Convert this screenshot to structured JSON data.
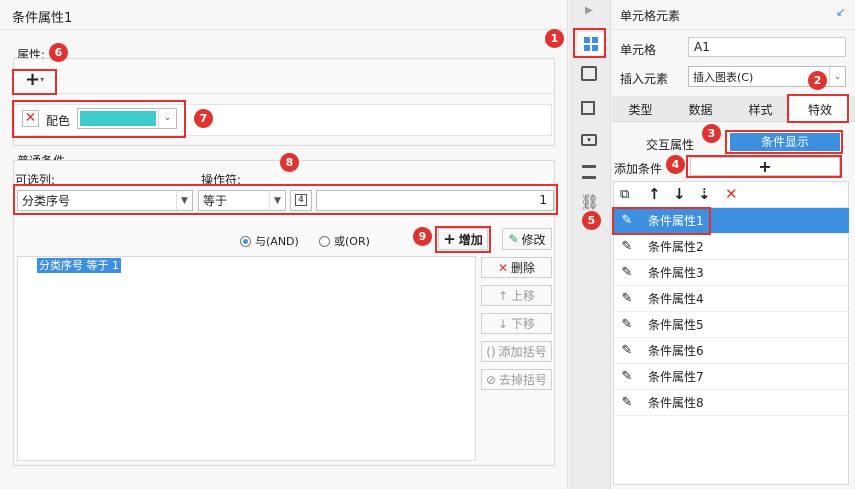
{
  "dialog": {
    "title": "条件属性1",
    "property_label": "属性:",
    "color_label": "配色",
    "color_value": "#3ecbcb",
    "general_condition_label": "普通条件",
    "optional_column_label": "可选列:",
    "operator_label": "操作符:",
    "column_value": "分类序号",
    "operator_value": "等于",
    "value_input": "1",
    "and_label": "与(AND)",
    "or_label": "或(OR)",
    "add_button": "增加",
    "modify_button": "修改",
    "delete_button": "删除",
    "move_up_button": "上移",
    "move_down_button": "下移",
    "add_bracket_button": "添加括号",
    "remove_bracket_button": "去掉括号",
    "condition_entry": "分类序号 等于 1",
    "format_glyph": "4"
  },
  "right_panel": {
    "title": "单元格元素",
    "cell_label": "单元格",
    "cell_value": "A1",
    "insert_label": "插入元素",
    "insert_value": "插入图表(C)",
    "tabs": [
      "类型",
      "数据",
      "样式",
      "特效"
    ],
    "sub_tabs": [
      "交互属性",
      "条件显示"
    ],
    "add_condition_label": "添加条件",
    "conditions": [
      "条件属性1",
      "条件属性2",
      "条件属性3",
      "条件属性4",
      "条件属性5",
      "条件属性6",
      "条件属性7",
      "条件属性8"
    ]
  },
  "badges": [
    "1",
    "2",
    "3",
    "4",
    "5",
    "6",
    "7",
    "8",
    "9"
  ],
  "colors": {
    "accent": "#3d8fe0",
    "badge": "#e0322f",
    "selected_row": "#3d8fe0"
  }
}
